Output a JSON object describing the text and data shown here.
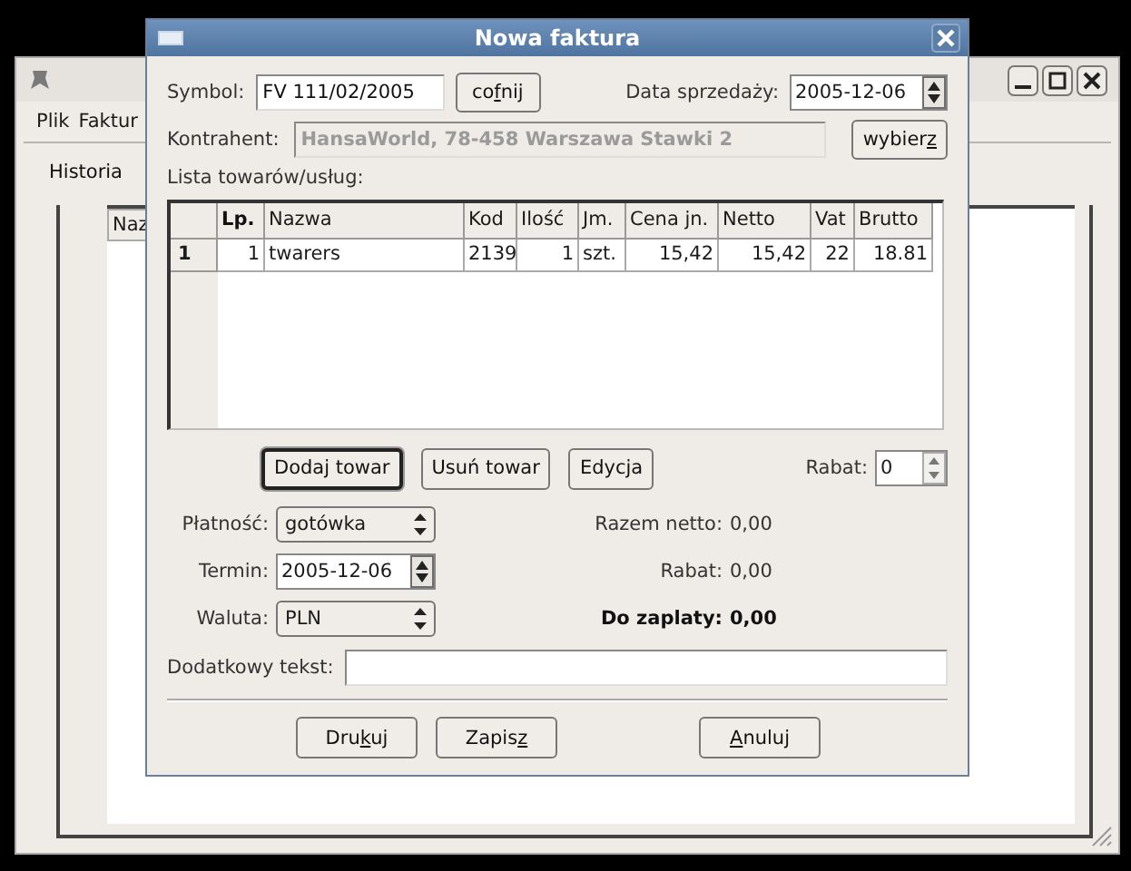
{
  "back_window": {
    "menu": [
      {
        "label": "Plik"
      },
      {
        "label": "Faktur"
      }
    ],
    "tabs": [
      {
        "label": "Historia",
        "selected": true
      }
    ],
    "table_header": "Naz"
  },
  "dialog": {
    "title": "Nowa faktura",
    "symbol": {
      "label": "Symbol:",
      "value": "FV 111/02/2005"
    },
    "undo_button": {
      "label": "co",
      "mnemonic": "f",
      "rest": "nij"
    },
    "sale_date": {
      "label": "Data sprzedaży:",
      "value": "2005-12-06"
    },
    "contractor": {
      "label": "Kontrahent:",
      "value": "HansaWorld, 78-458 Warszawa Stawki 2",
      "disabled": true
    },
    "choose_button": {
      "label": "wybier",
      "mnemonic": "z"
    },
    "items_label": "Lista towarów/usług:",
    "table": {
      "columns": [
        {
          "label": "Lp.",
          "kind": "number",
          "bold": true
        },
        {
          "label": "Nazwa",
          "kind": "text",
          "bold": false
        },
        {
          "label": "Kod",
          "kind": "text",
          "bold": false
        },
        {
          "label": "Ilość",
          "kind": "number",
          "bold": false
        },
        {
          "label": "Jm.",
          "kind": "text",
          "bold": false
        },
        {
          "label": "Cena jn.",
          "kind": "number",
          "bold": false
        },
        {
          "label": "Netto",
          "kind": "number",
          "bold": false
        },
        {
          "label": "Vat",
          "kind": "number",
          "bold": false
        },
        {
          "label": "Brutto",
          "kind": "number",
          "bold": false
        }
      ],
      "rows": [
        {
          "header": "1",
          "cells": [
            "1",
            "twarers",
            "2139",
            "1",
            "szt.",
            "15,42",
            "15,42",
            "22",
            "18.81"
          ]
        }
      ]
    },
    "item_buttons": [
      {
        "label": "Dodaj towar",
        "default": true
      },
      {
        "label": "Usuń towar",
        "default": false
      },
      {
        "label": "Edycja",
        "default": false
      }
    ],
    "discount": {
      "label": "Rabat:",
      "value": "0"
    },
    "form_fields": [
      {
        "label": "Płatność:",
        "value": "gotówka",
        "kind": "combo"
      },
      {
        "label": "Termin:",
        "value": "2005-12-06",
        "kind": "date"
      },
      {
        "label": "Waluta:",
        "value": "PLN",
        "kind": "combo"
      }
    ],
    "totals": [
      {
        "label": "Razem netto:",
        "value": "0,00",
        "bold": false
      },
      {
        "label": "Rabat:",
        "value": "0,00",
        "bold": false
      },
      {
        "label": "Do zaplaty:",
        "value": "0,00",
        "bold": true
      }
    ],
    "extra_text": {
      "label": "Dodatkowy tekst:"
    },
    "footer_buttons": [
      {
        "label": "Dru",
        "mnemonic": "k",
        "rest": "uj"
      },
      {
        "label": "Zapis",
        "mnemonic": "z"
      },
      {
        "mnemonic": "A",
        "rest": "nuluj"
      }
    ]
  }
}
